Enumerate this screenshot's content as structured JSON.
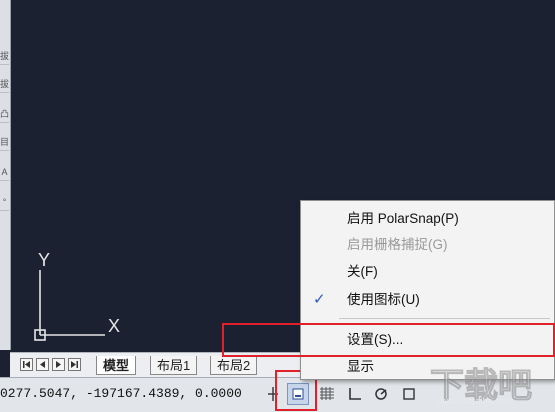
{
  "left_toolbar": {
    "glyphs": [
      "拔",
      "拔",
      "凸",
      "目",
      "A",
      "°"
    ]
  },
  "canvas": {
    "ucs_y_label": "Y",
    "ucs_x_label": "X"
  },
  "layout_tabs": {
    "tabs": [
      {
        "label": "模型",
        "active": true
      },
      {
        "label": "布局1",
        "active": false
      },
      {
        "label": "布局2",
        "active": false
      }
    ]
  },
  "status_bar": {
    "coordinates": "0277.5047,  -197167.4389, 0.0000"
  },
  "context_menu": {
    "items": [
      {
        "label": "启用 PolarSnap(P)",
        "disabled": false,
        "checked": false
      },
      {
        "label": "启用栅格捕捉(G)",
        "disabled": true,
        "checked": false
      },
      {
        "label": "关(F)",
        "disabled": false,
        "checked": false
      },
      {
        "label": "使用图标(U)",
        "disabled": false,
        "checked": true
      },
      {
        "label": "设置(S)...",
        "disabled": false,
        "checked": false
      },
      {
        "label": "显示",
        "disabled": false,
        "checked": false
      }
    ],
    "check_glyph": "✓"
  },
  "highlight_color": "#e0202a",
  "watermark": {
    "text": "下载吧",
    "subtext": "www.xiazaiba.com"
  }
}
